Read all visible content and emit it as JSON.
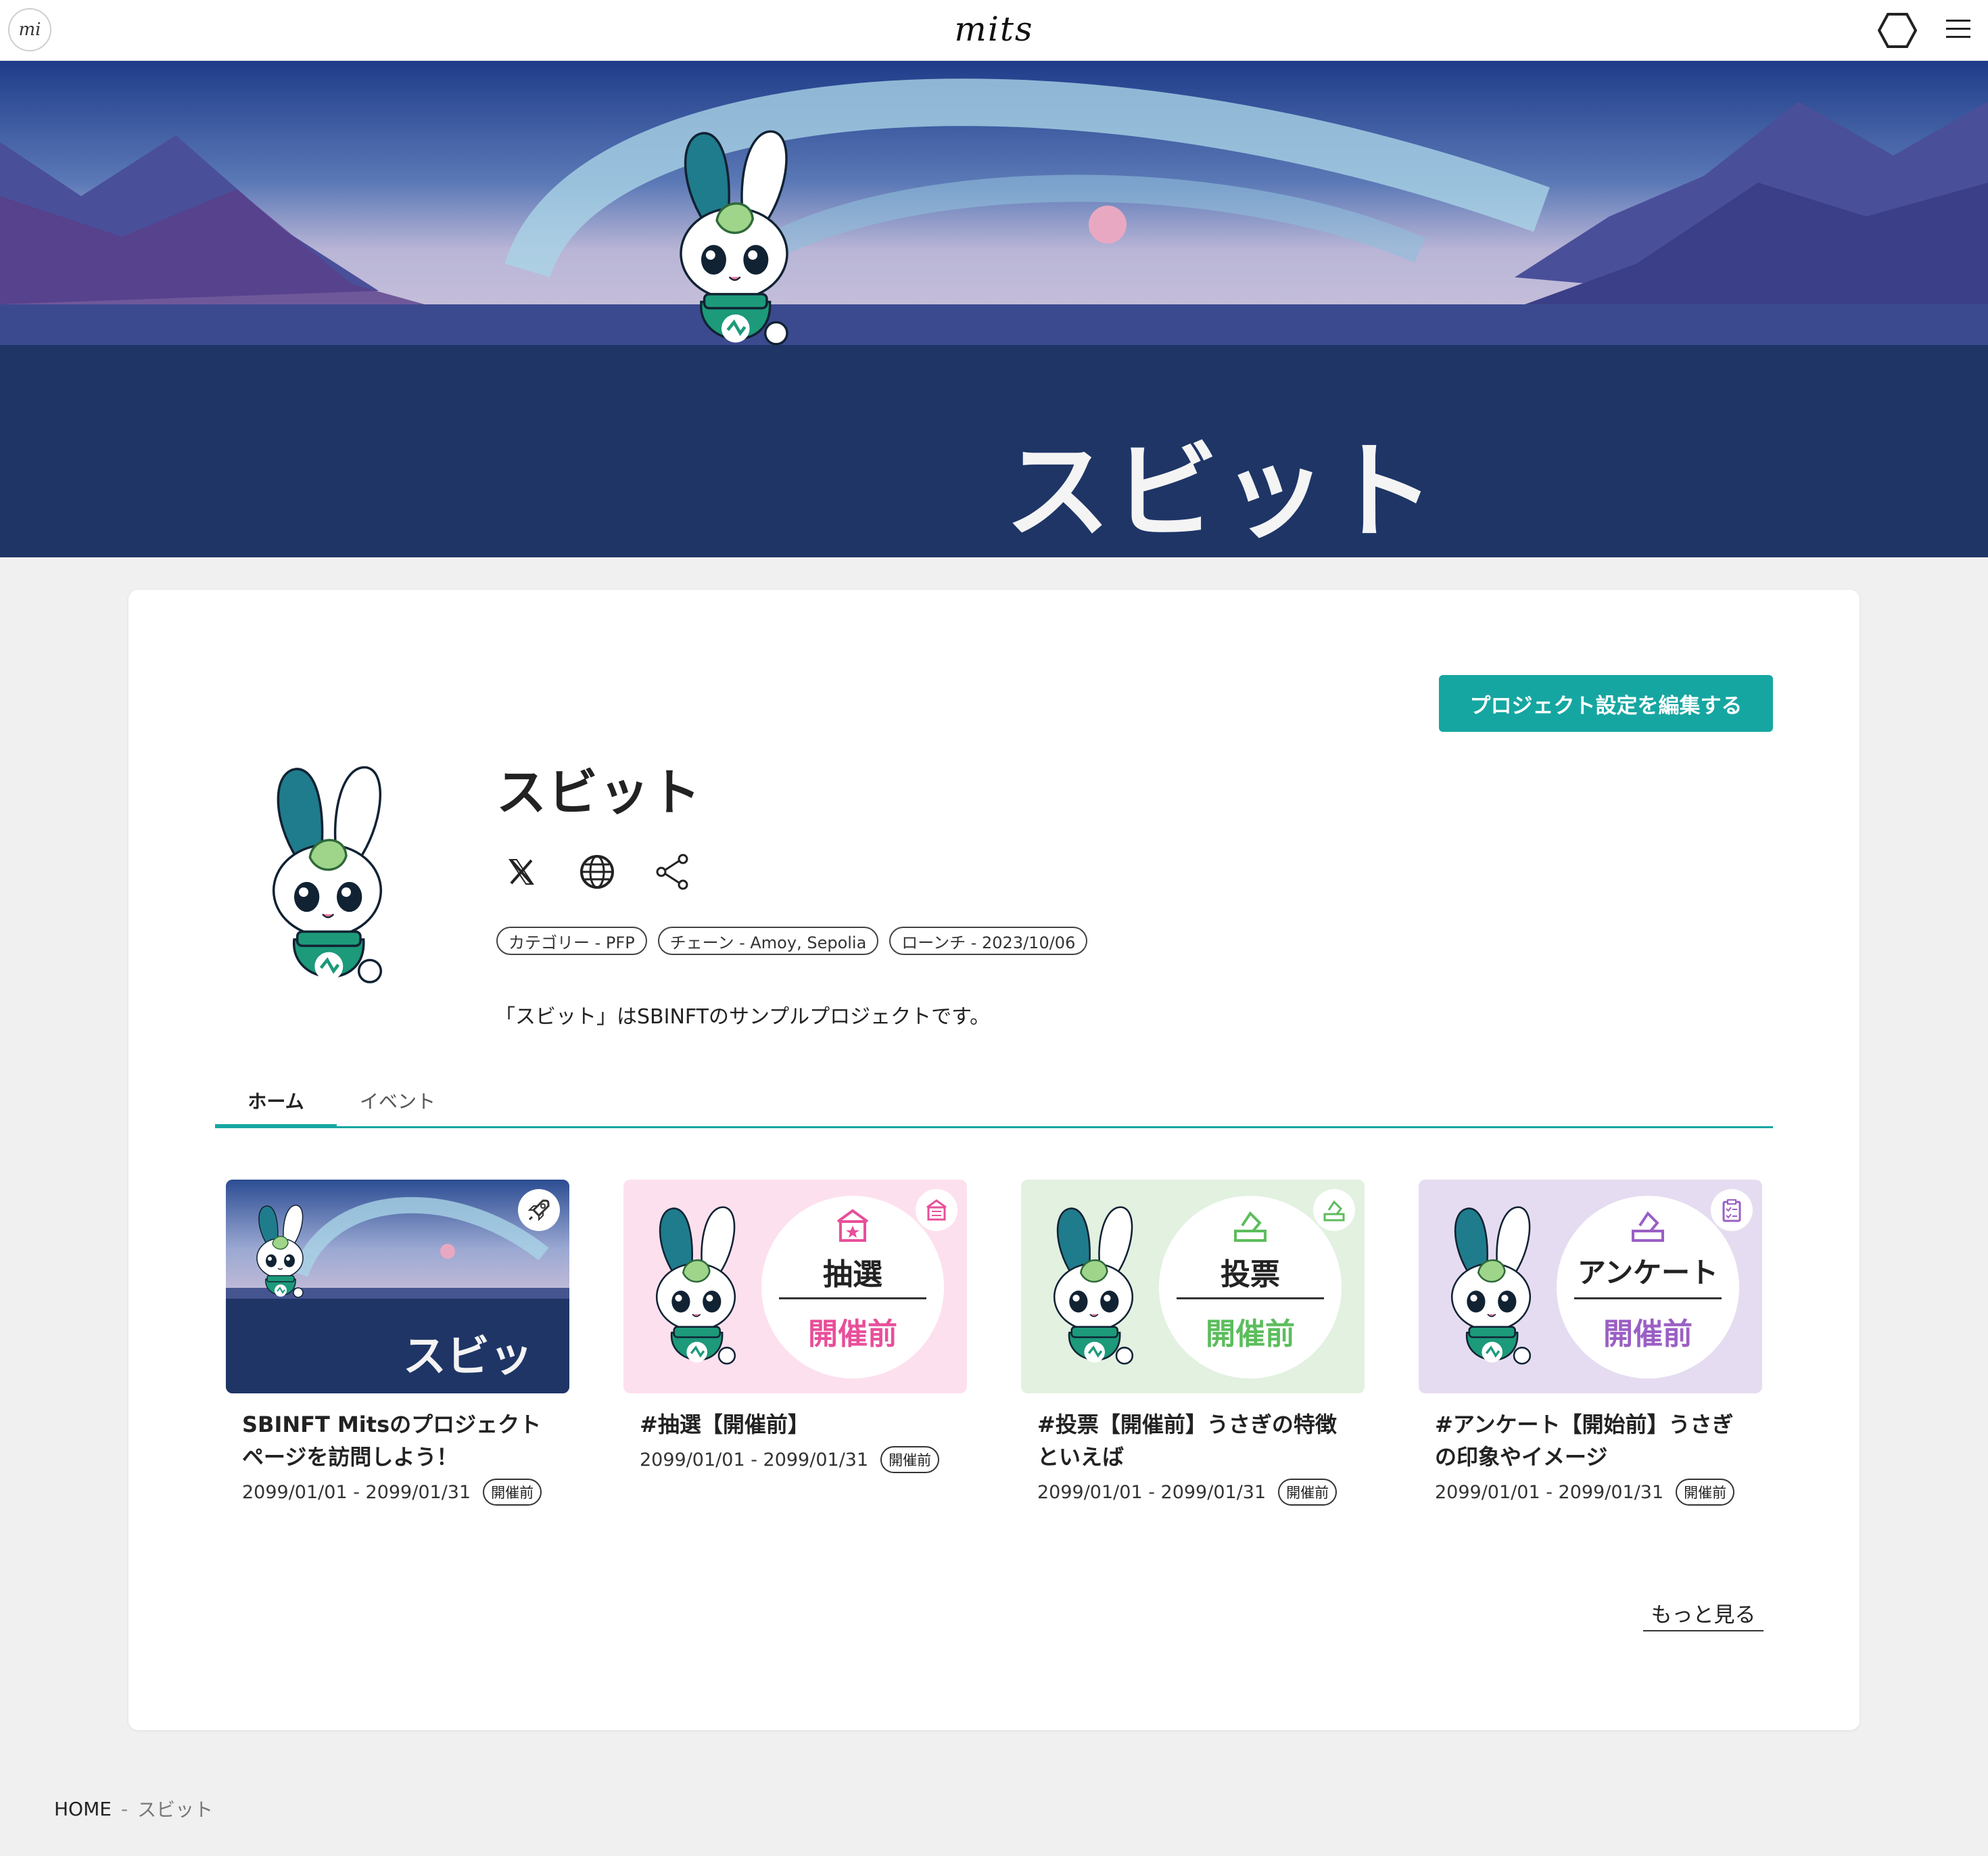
{
  "header": {
    "left_logo": "mi",
    "brand": "mits",
    "wallet_icon": "hexagon-icon",
    "menu_icon": "hamburger-menu-icon"
  },
  "hero": {
    "title": "スビット"
  },
  "project": {
    "edit_button": "プロジェクト設定を編集する",
    "name": "スビット",
    "social_icons": [
      "x-icon",
      "globe-icon",
      "share-icon"
    ],
    "tags": [
      "カテゴリー - PFP",
      "チェーン - Amoy, Sepolia",
      "ローンチ - 2023/10/06"
    ],
    "description": "「スビット」はSBINFTのサンプルプロジェクトです。"
  },
  "tabs": [
    {
      "label": "ホーム",
      "active": true
    },
    {
      "label": "イベント",
      "active": false
    }
  ],
  "events": [
    {
      "thumb_kind": "banner",
      "thumb_text": "スビット",
      "corner_icon": "rocket-icon",
      "title": "SBINFT Mitsのプロジェクトページを訪問しよう！",
      "dates": "2099/01/01 - 2099/01/31",
      "badge": "開催前"
    },
    {
      "thumb_kind": "lottery",
      "thumb_label": "抽選",
      "thumb_state": "開催前",
      "corner_icon": "lottery-shop-icon",
      "title": "#抽選【開催前】",
      "dates": "2099/01/01 - 2099/01/31",
      "badge": "開催前"
    },
    {
      "thumb_kind": "vote",
      "thumb_label": "投票",
      "thumb_state": "開催前",
      "corner_icon": "ballot-box-icon",
      "title": "#投票【開催前】うさぎの特徴といえば",
      "dates": "2099/01/01 - 2099/01/31",
      "badge": "開催前"
    },
    {
      "thumb_kind": "survey",
      "thumb_label": "アンケート",
      "thumb_state": "開催前",
      "corner_icon": "clipboard-check-icon",
      "title": "#アンケート【開始前】うさぎの印象やイメージ",
      "dates": "2099/01/01 - 2099/01/31",
      "badge": "開催前"
    }
  ],
  "more_link": "もっと見る",
  "breadcrumb": {
    "home": "HOME",
    "separator": "-",
    "current": "スビット"
  },
  "colors": {
    "accent": "#16a6a1",
    "lottery_bg": "#fde0ee",
    "lottery_accent": "#e84f9a",
    "vote_bg": "#e2f1e0",
    "vote_accent": "#5cbd5c",
    "survey_bg": "#e6dcf1",
    "survey_accent": "#9a5fc4",
    "hero_sky": "#2a3f82",
    "hero_ground": "#1e3566"
  }
}
